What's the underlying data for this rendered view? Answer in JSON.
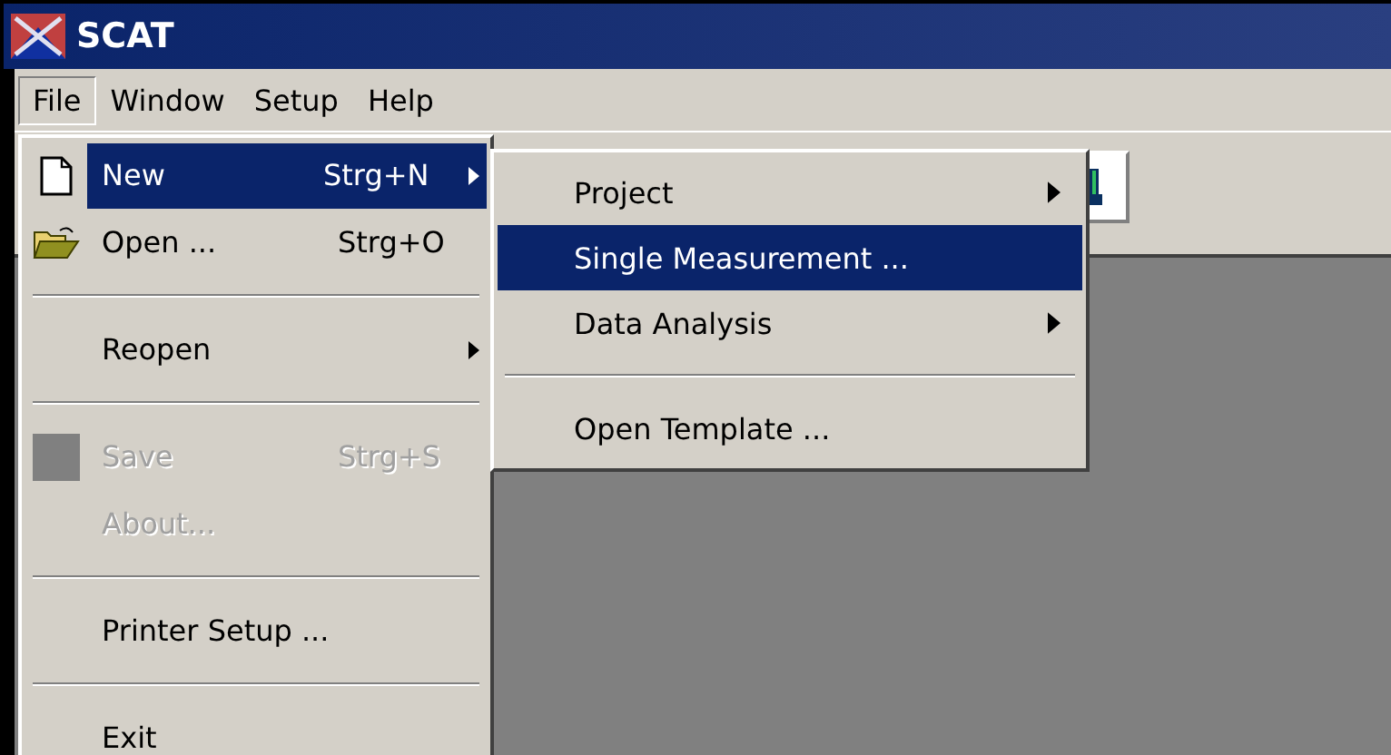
{
  "window": {
    "title": "SCAT"
  },
  "menubar": [
    {
      "label": "File",
      "selected": true
    },
    {
      "label": "Window",
      "selected": false
    },
    {
      "label": "Setup",
      "selected": false
    },
    {
      "label": "Help",
      "selected": false
    }
  ],
  "file_menu": [
    {
      "kind": "item",
      "label": "New",
      "shortcut": "Strg+N",
      "submenu": true,
      "selected": true,
      "disabled": false
    },
    {
      "kind": "item",
      "label": "Open ...",
      "shortcut": "Strg+O",
      "submenu": false,
      "selected": false,
      "disabled": false
    },
    {
      "kind": "separator"
    },
    {
      "kind": "item",
      "label": "Reopen",
      "submenu": true,
      "selected": false,
      "disabled": false
    },
    {
      "kind": "separator"
    },
    {
      "kind": "item",
      "label": "Save",
      "shortcut": "Strg+S",
      "submenu": false,
      "selected": false,
      "disabled": true
    },
    {
      "kind": "item",
      "label": "About...",
      "submenu": false,
      "selected": false,
      "disabled": true
    },
    {
      "kind": "separator"
    },
    {
      "kind": "item",
      "label": "Printer Setup ...",
      "submenu": false,
      "selected": false,
      "disabled": false
    },
    {
      "kind": "separator"
    },
    {
      "kind": "item",
      "label": "Exit",
      "submenu": false,
      "selected": false,
      "disabled": false
    }
  ],
  "new_submenu": [
    {
      "kind": "item",
      "label": "Project",
      "submenu": true,
      "selected": false,
      "disabled": false
    },
    {
      "kind": "item",
      "label": "Single Measurement ...",
      "submenu": false,
      "selected": true,
      "disabled": false
    },
    {
      "kind": "item",
      "label": "Data Analysis",
      "submenu": true,
      "selected": false,
      "disabled": false
    },
    {
      "kind": "separator"
    },
    {
      "kind": "item",
      "label": "Open Template ...",
      "submenu": false,
      "selected": false,
      "disabled": false
    }
  ]
}
